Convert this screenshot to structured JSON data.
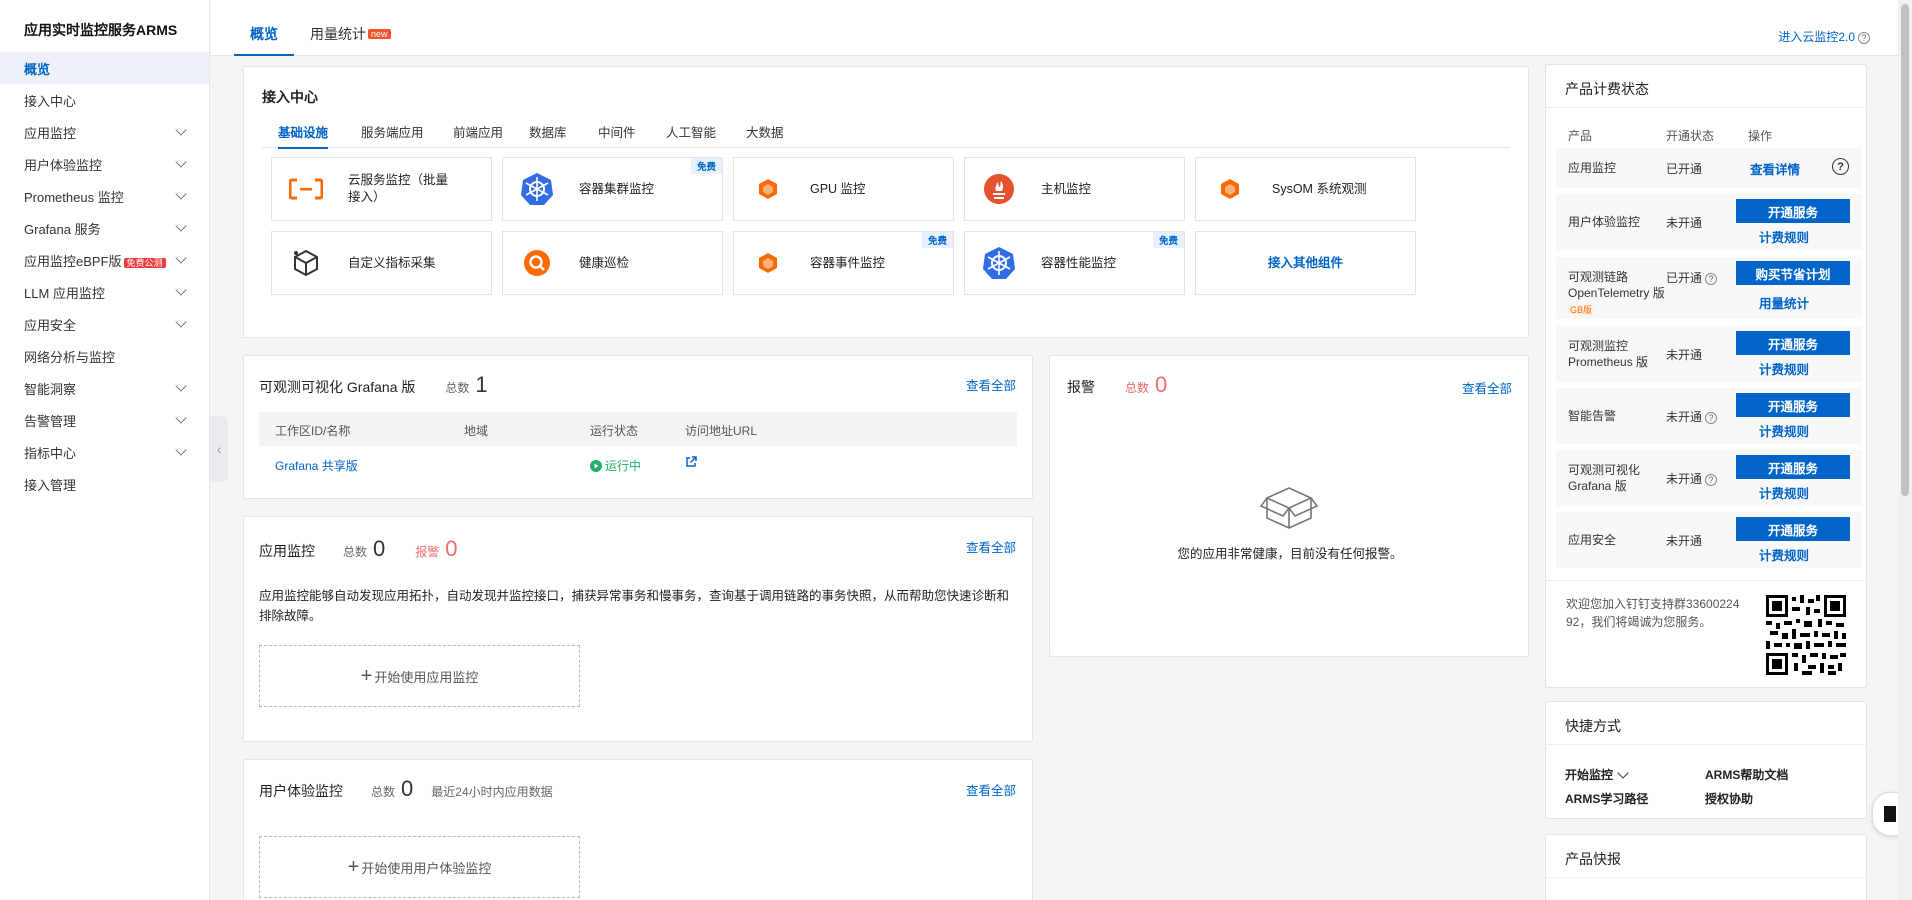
{
  "sidebar": {
    "title": "应用实时监控服务ARMS",
    "items": [
      {
        "label": "概览"
      },
      {
        "label": "接入中心"
      },
      {
        "label": "应用监控"
      },
      {
        "label": "用户体验监控"
      },
      {
        "label": "Prometheus 监控"
      },
      {
        "label": "Grafana 服务"
      },
      {
        "label": "应用监控eBPF版",
        "badge": "免费公测"
      },
      {
        "label": "LLM 应用监控"
      },
      {
        "label": "应用安全"
      },
      {
        "label": "网络分析与监控"
      },
      {
        "label": "智能洞察"
      },
      {
        "label": "告警管理"
      },
      {
        "label": "指标中心"
      },
      {
        "label": "接入管理"
      }
    ]
  },
  "topbar": {
    "tabs": [
      {
        "label": "概览"
      },
      {
        "label": "用量统计"
      }
    ],
    "new_badge": "new",
    "cloud_link": "进入云监控2.0"
  },
  "access": {
    "title": "接入中心",
    "tabs": [
      "基础设施",
      "服务端应用",
      "前端应用",
      "数据库",
      "中间件",
      "人工智能",
      "大数据"
    ],
    "tiles": [
      {
        "label": "云服务监控（批量接入）",
        "icon": "cloud-bracket-icon"
      },
      {
        "label": "容器集群监控",
        "icon": "kubernetes-icon",
        "badge": "免费"
      },
      {
        "label": "GPU 监控",
        "icon": "hexagon-icon"
      },
      {
        "label": "主机监控",
        "icon": "prometheus-icon"
      },
      {
        "label": "SysOM 系统观测",
        "icon": "hexagon-icon"
      },
      {
        "label": "自定义指标采集",
        "icon": "cube-icon"
      },
      {
        "label": "健康巡检",
        "icon": "search-icon"
      },
      {
        "label": "容器事件监控",
        "icon": "hexagon-icon",
        "badge": "免费"
      },
      {
        "label": "容器性能监控",
        "icon": "kubernetes-icon",
        "badge": "免费"
      },
      {
        "label": "接入其他组件"
      }
    ]
  },
  "grafana": {
    "title": "可观测可视化 Grafana 版",
    "count_label": "总数",
    "count": "1",
    "view_all": "查看全部",
    "columns": [
      "工作区ID/名称",
      "地域",
      "运行状态",
      "访问地址URL"
    ],
    "rows": [
      {
        "name": "Grafana 共享版",
        "region": "",
        "status": "运行中"
      }
    ]
  },
  "alarm": {
    "title": "报警",
    "count_label": "总数",
    "count": "0",
    "view_all": "查看全部",
    "empty_text": "您的应用非常健康，目前没有任何报警。"
  },
  "app_monitor": {
    "title": "应用监控",
    "count_label": "总数",
    "count": "0",
    "alarm_label": "报警",
    "alarm_count": "0",
    "view_all": "查看全部",
    "desc": "应用监控能够自动发现应用拓扑，自动发现并监控接口，捕获异常事务和慢事务，查询基于调用链路的事务快照，从而帮助您快速诊断和排除故障。",
    "start": "开始使用应用监控"
  },
  "ux_monitor": {
    "title": "用户体验监控",
    "count_label": "总数",
    "count": "0",
    "note": "最近24小时内应用数据",
    "view_all": "查看全部",
    "start": "开始使用用户体验监控"
  },
  "billing": {
    "title": "产品计费状态",
    "headers": [
      "产品",
      "开通状态",
      "操作"
    ],
    "rows": [
      {
        "name": "应用监控",
        "status": "已开通",
        "action": "查看详情"
      },
      {
        "name": "用户体验监控",
        "status": "未开通",
        "btn": "开通服务",
        "link": "计费规则"
      },
      {
        "name": "可观测链路 OpenTelemetry 版",
        "tag": "GB版",
        "status": "已开通",
        "btn": "购买节省计划",
        "link": "用量统计"
      },
      {
        "name": "可观测监控 Prometheus 版",
        "status": "未开通",
        "btn": "开通服务",
        "link": "计费规则"
      },
      {
        "name": "智能告警",
        "status": "未开通",
        "btn": "开通服务",
        "link": "计费规则"
      },
      {
        "name": "可观测可视化 Grafana 版",
        "status": "未开通",
        "btn": "开通服务",
        "link": "计费规则"
      },
      {
        "name": "应用安全",
        "status": "未开通",
        "btn": "开通服务",
        "link": "计费规则"
      }
    ],
    "dingtalk": "欢迎您加入钉钉支持群3360022492，我们将竭诚为您服务。"
  },
  "shortcuts": {
    "title": "快捷方式",
    "items": [
      "开始监控",
      "ARMS帮助文档",
      "ARMS学习路径",
      "授权协助"
    ]
  },
  "news": {
    "title": "产品快报"
  },
  "colors": {
    "primary": "#0064c8",
    "alarm": "#f36a6a",
    "success": "#23b066",
    "orange": "#ff6a00"
  }
}
